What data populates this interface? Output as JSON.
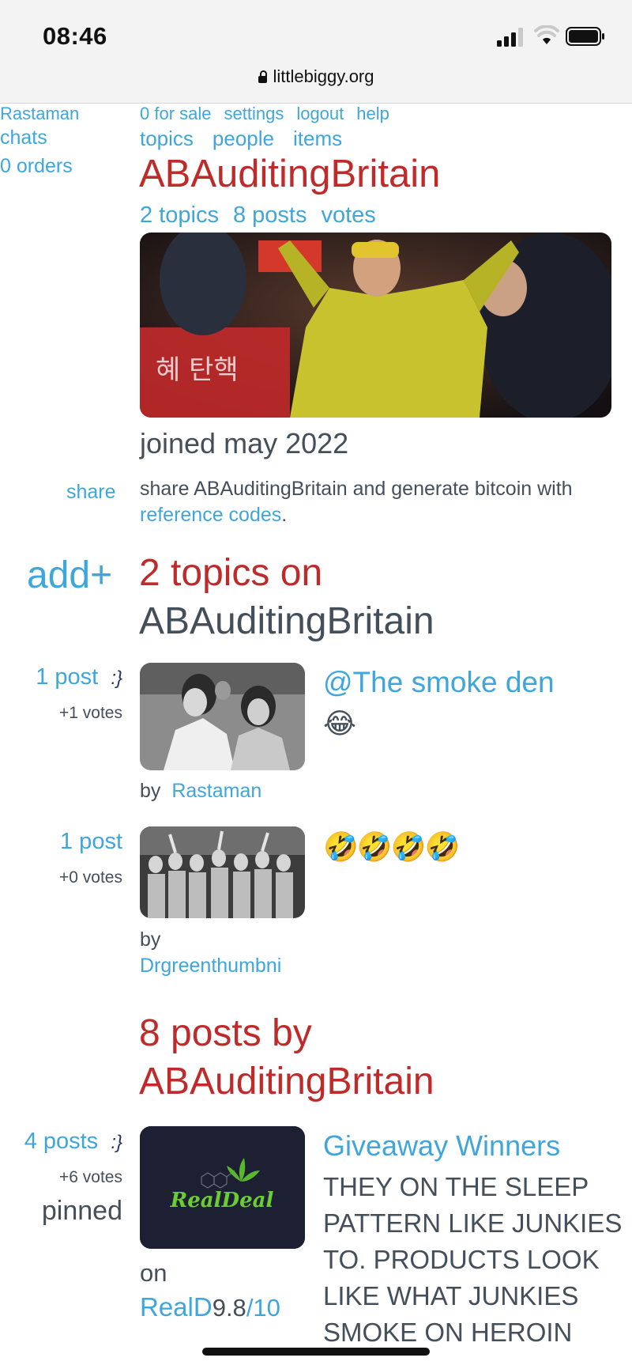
{
  "status_bar": {
    "time": "08:46",
    "url": "littlebiggy.org"
  },
  "left": {
    "user": "Rastaman",
    "chats": "chats",
    "orders": "0 orders"
  },
  "nav": {
    "row1": [
      "0 for sale",
      "settings",
      "logout",
      "help"
    ],
    "row2": [
      "topics",
      "people",
      "items"
    ]
  },
  "profile": {
    "name": "ABAuditingBritain",
    "stats": [
      "2 topics",
      "8 posts",
      "votes"
    ],
    "joined": "joined may 2022"
  },
  "share": {
    "label": "share",
    "text": "share ABAuditingBritain and generate bitcoin with ",
    "link": "reference codes",
    "period": "."
  },
  "topics_section": {
    "add_label": "add+",
    "heading_line1": "2 topics on",
    "heading_line2": "ABAuditingBritain",
    "items": [
      {
        "posts": "1 post",
        "posts_icon": ":}",
        "votes": "+1 votes",
        "title": "@The smoke den",
        "emoji": "😂",
        "by": "by",
        "author": "Rastaman"
      },
      {
        "posts": "1 post",
        "votes": "+0 votes",
        "emoji": "🤣🤣🤣🤣",
        "by": "by",
        "author": "Drgreenthumbni"
      }
    ]
  },
  "posts_section": {
    "heading_line1": "8 posts by",
    "heading_line2": "ABAuditingBritain",
    "items": [
      {
        "posts": "4 posts",
        "posts_icon": ":}",
        "votes": "+6 votes",
        "pinned": "pinned",
        "logo_text": "RealDeal",
        "on": "on",
        "store": "RealD",
        "rating": "9.8",
        "rating_max": "/10",
        "title": "Giveaway Winners",
        "body": "THEY ON THE SLEEP PATTERN LIKE JUNKIES TO. PRODUCTS LOOK LIKE WHAT JUNKIES SMOKE ON HEROIN"
      }
    ]
  },
  "colors": {
    "link": "#3fa6db",
    "heading": "#bf2a2a",
    "text": "#454f5a"
  }
}
